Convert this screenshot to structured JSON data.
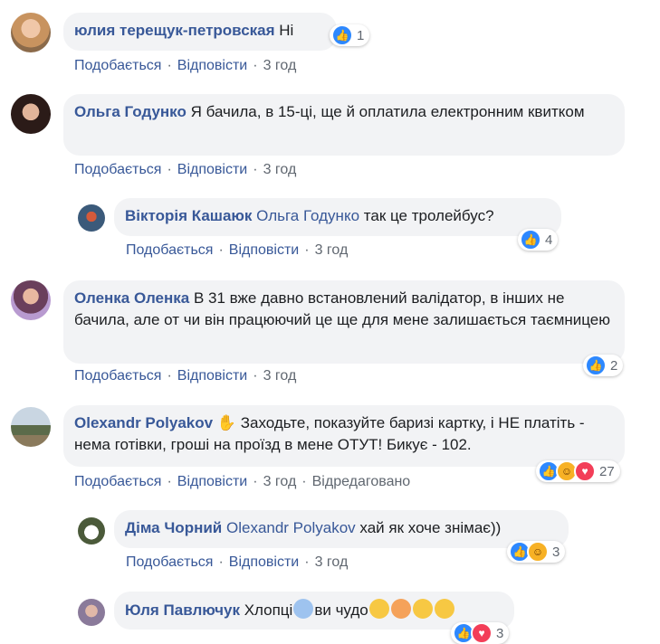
{
  "comments": [
    {
      "author": "юлия терещук-петровская",
      "text": "Ні",
      "like_label": "Подобається",
      "reply_label": "Відповісти",
      "time": "3 год",
      "reaction_count": "1"
    },
    {
      "author": "Ольга Годунко",
      "text": "Я бачила, в 15-ці, ще й оплатила електронним квитком",
      "like_label": "Подобається",
      "reply_label": "Відповісти",
      "time": "3 год"
    },
    {
      "author": "Вікторія Кашаюк",
      "mention": "Ольга Годунко",
      "text": "так це тролейбус?",
      "like_label": "Подобається",
      "reply_label": "Відповісти",
      "time": "3 год",
      "reaction_count": "4"
    },
    {
      "author": "Оленка Оленка",
      "text": "В 31 вже давно встановлений валідатор, в інших не бачила, але от чи він працюючий це ще для мене залишається таємницею",
      "like_label": "Подобається",
      "reply_label": "Відповісти",
      "time": "3 год",
      "reaction_count": "2"
    },
    {
      "author": "Olexandr Polyakov",
      "text": "Заходьте, показуйте баризі картку, і НЕ платіть - нема готівки, гроші на проїзд в мене ОТУТ! Бикує - 102.",
      "like_label": "Подобається",
      "reply_label": "Відповісти",
      "time": "3 год",
      "edited_label": "Відредаговано",
      "reaction_count": "27"
    },
    {
      "author": "Діма Чорний",
      "mention": "Olexandr Polyakov",
      "text": "хай як хоче знімає))",
      "like_label": "Подобається",
      "reply_label": "Відповісти",
      "time": "3 год",
      "reaction_count": "3"
    },
    {
      "author": "Юля Павлючук",
      "text_a": "Хлопці",
      "text_b": "ви чудо",
      "reaction_count": "3"
    }
  ],
  "colors": {
    "link": "#385898",
    "bubble": "#f2f3f5",
    "meta": "#606770",
    "like": "#2d88ff",
    "haha": "#f7b125",
    "love": "#f33e58"
  },
  "icons": {
    "like": "thumbs-up-icon",
    "haha": "haha-icon",
    "love": "heart-icon",
    "wave": "waving-hand-icon"
  }
}
